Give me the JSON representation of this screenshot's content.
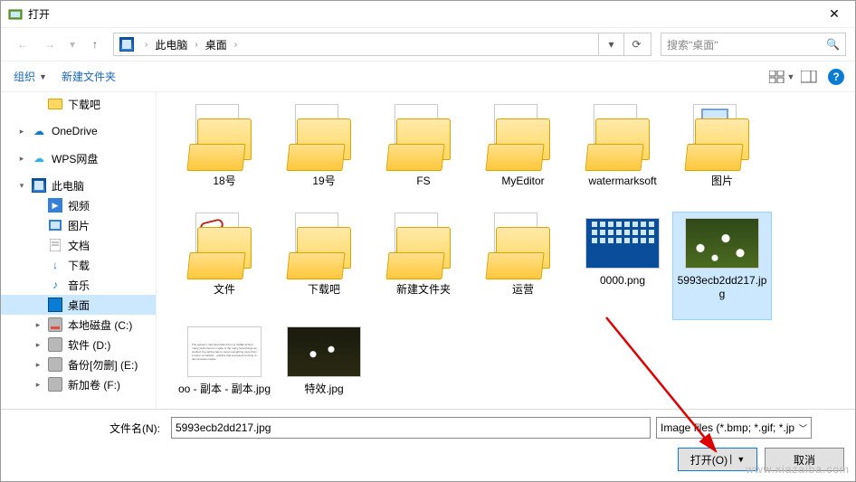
{
  "window": {
    "title": "打开"
  },
  "nav": {
    "crumbs": [
      "此电脑",
      "桌面"
    ],
    "refresh_dropdown_label": "v",
    "search_placeholder": "搜索\"桌面\""
  },
  "toolbar": {
    "organize_label": "组织",
    "new_folder_label": "新建文件夹"
  },
  "tree": [
    {
      "label": "下载吧",
      "level": 2,
      "icon": "folder",
      "caret": ""
    },
    {
      "gap": true
    },
    {
      "label": "OneDrive",
      "level": 1,
      "icon": "cloud-blue",
      "caret": "▸"
    },
    {
      "gap": true
    },
    {
      "label": "WPS网盘",
      "level": 1,
      "icon": "cloud-lt",
      "caret": "▸"
    },
    {
      "gap": true
    },
    {
      "label": "此电脑",
      "level": 1,
      "icon": "pc",
      "caret": "▾"
    },
    {
      "label": "视频",
      "level": 2,
      "icon": "video",
      "caret": ""
    },
    {
      "label": "图片",
      "level": 2,
      "icon": "pic",
      "caret": ""
    },
    {
      "label": "文档",
      "level": 2,
      "icon": "docf",
      "caret": ""
    },
    {
      "label": "下载",
      "level": 2,
      "icon": "dl",
      "caret": ""
    },
    {
      "label": "音乐",
      "level": 2,
      "icon": "music",
      "caret": ""
    },
    {
      "label": "桌面",
      "level": 2,
      "icon": "desk",
      "caret": "",
      "selected": true
    },
    {
      "label": "本地磁盘 (C:)",
      "level": 2,
      "icon": "disk-c",
      "caret": "▸"
    },
    {
      "label": "软件 (D:)",
      "level": 2,
      "icon": "disk",
      "caret": "▸"
    },
    {
      "label": "备份[勿删] (E:)",
      "level": 2,
      "icon": "disk",
      "caret": "▸"
    },
    {
      "label": "新加卷 (F:)",
      "level": 2,
      "icon": "disk",
      "caret": "▸"
    }
  ],
  "items": [
    {
      "label": "18号",
      "thumb": "folder"
    },
    {
      "label": "19号",
      "thumb": "folder"
    },
    {
      "label": "FS",
      "thumb": "folder"
    },
    {
      "label": "MyEditor",
      "thumb": "folder"
    },
    {
      "label": "watermarksoft",
      "thumb": "folder"
    },
    {
      "label": "图片",
      "thumb": "folder-gallery"
    },
    {
      "label": "文件",
      "thumb": "folder-sticker"
    },
    {
      "label": "下载吧",
      "thumb": "folder"
    },
    {
      "label": "新建文件夹",
      "thumb": "folder"
    },
    {
      "label": "运营",
      "thumb": "folder"
    },
    {
      "label": "0000.png",
      "thumb": "desk0"
    },
    {
      "label": "5993ecb2dd217.jpg",
      "thumb": "grass",
      "selected": true
    },
    {
      "label": "oo - 副本 - 副本.jpg",
      "thumb": "doc"
    },
    {
      "label": "特效.jpg",
      "thumb": "darkgrass"
    }
  ],
  "footer": {
    "filename_label": "文件名(N):",
    "filename_value": "5993ecb2dd217.jpg",
    "filter_label": "Image files (*.bmp; *.gif; *.jp",
    "open_label": "打开(O)",
    "cancel_label": "取消",
    "watermark": "www.xiazaiba.com"
  }
}
